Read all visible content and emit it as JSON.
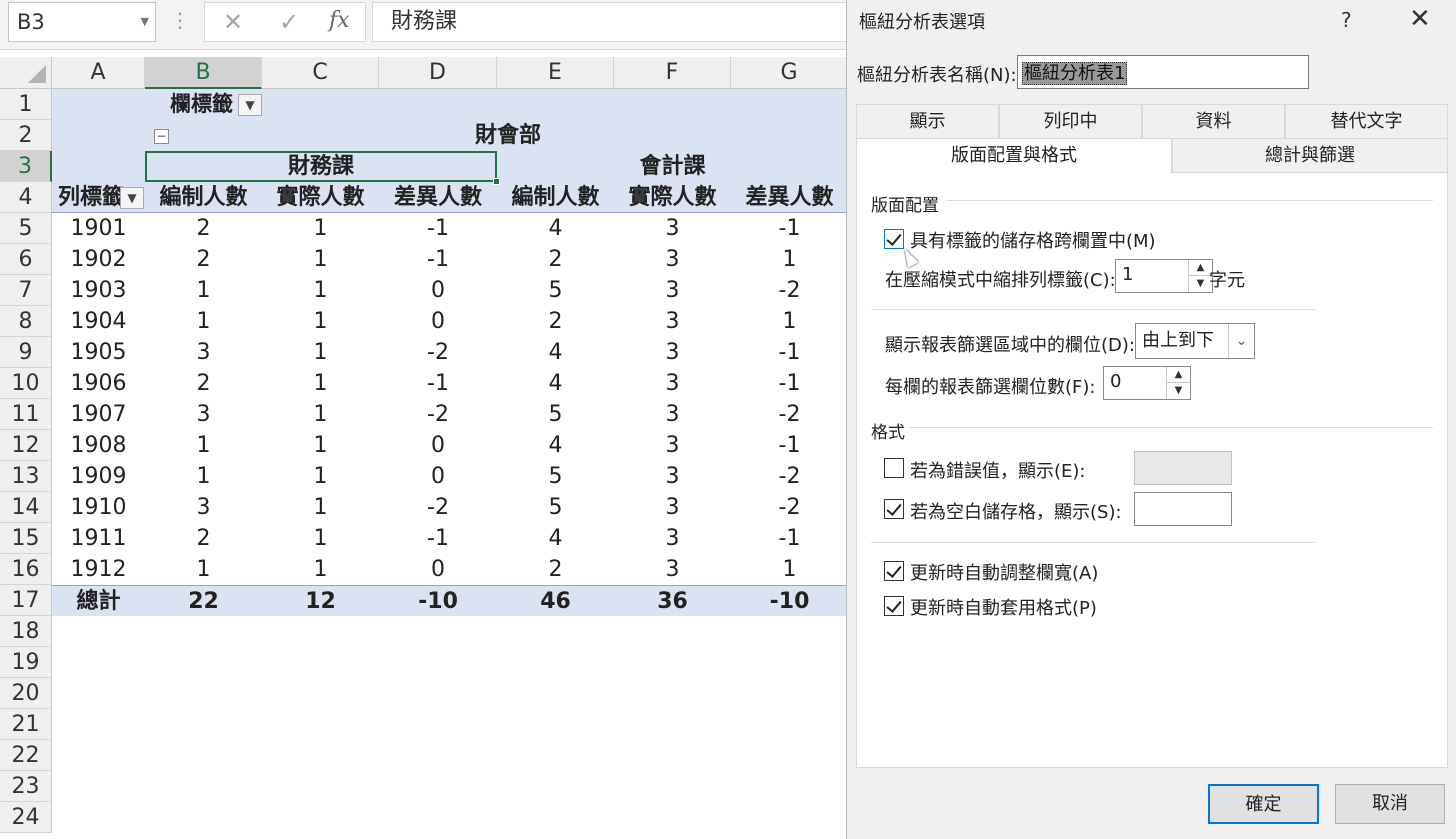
{
  "formula_bar": {
    "name_box": "B3",
    "cancel_icon": "✕",
    "enter_icon": "✓",
    "fx_icon": "fx",
    "content": "財務課"
  },
  "sheet": {
    "columns": [
      "A",
      "B",
      "C",
      "D",
      "E",
      "F",
      "G"
    ],
    "rows": [
      "1",
      "2",
      "3",
      "4",
      "5",
      "6",
      "7",
      "8",
      "9",
      "10",
      "11",
      "12",
      "13",
      "14",
      "15",
      "16",
      "17",
      "18",
      "19",
      "20",
      "21",
      "22",
      "23",
      "24"
    ],
    "selected_column": "B",
    "selected_row": "3",
    "band_color": "#dbe2f2",
    "pivot": {
      "column_labels_header": "欄標籤",
      "row_labels_header": "列標籤",
      "dept": "財會部",
      "group1": "財務課",
      "group2": "會計課",
      "measure_headers": [
        "編制人數",
        "實際人數",
        "差異人數",
        "編制人數",
        "實際人數",
        "差異人數"
      ],
      "rows": [
        {
          "label": "1901",
          "values": [
            "2",
            "1",
            "-1",
            "4",
            "3",
            "-1"
          ]
        },
        {
          "label": "1902",
          "values": [
            "2",
            "1",
            "-1",
            "2",
            "3",
            "1"
          ]
        },
        {
          "label": "1903",
          "values": [
            "1",
            "1",
            "0",
            "5",
            "3",
            "-2"
          ]
        },
        {
          "label": "1904",
          "values": [
            "1",
            "1",
            "0",
            "2",
            "3",
            "1"
          ]
        },
        {
          "label": "1905",
          "values": [
            "3",
            "1",
            "-2",
            "4",
            "3",
            "-1"
          ]
        },
        {
          "label": "1906",
          "values": [
            "2",
            "1",
            "-1",
            "4",
            "3",
            "-1"
          ]
        },
        {
          "label": "1907",
          "values": [
            "3",
            "1",
            "-2",
            "5",
            "3",
            "-2"
          ]
        },
        {
          "label": "1908",
          "values": [
            "1",
            "1",
            "0",
            "4",
            "3",
            "-1"
          ]
        },
        {
          "label": "1909",
          "values": [
            "1",
            "1",
            "0",
            "5",
            "3",
            "-2"
          ]
        },
        {
          "label": "1910",
          "values": [
            "3",
            "1",
            "-2",
            "5",
            "3",
            "-2"
          ]
        },
        {
          "label": "1911",
          "values": [
            "2",
            "1",
            "-1",
            "4",
            "3",
            "-1"
          ]
        },
        {
          "label": "1912",
          "values": [
            "1",
            "1",
            "0",
            "2",
            "3",
            "1"
          ]
        }
      ],
      "total": {
        "label": "總計",
        "values": [
          "22",
          "12",
          "-10",
          "46",
          "36",
          "-10"
        ]
      }
    }
  },
  "dialog": {
    "title": "樞紐分析表選項",
    "help": "?",
    "close": "✕",
    "name_label": "樞紐分析表名稱(N):",
    "name_value": "樞紐分析表1",
    "tabs_row1": [
      "顯示",
      "列印中",
      "資料",
      "替代文字"
    ],
    "tabs_row2": [
      "版面配置與格式",
      "總計與篩選"
    ],
    "active_tab": "版面配置與格式",
    "layout_section": "版面配置",
    "merge_center": {
      "label": "具有標籤的儲存格跨欄置中(M)",
      "checked": true
    },
    "indent": {
      "label": "在壓縮模式中縮排列標籤(C):",
      "value": "1",
      "unit": "字元"
    },
    "filter_order": {
      "label": "顯示報表篩選區域中的欄位(D):",
      "value": "由上到下"
    },
    "filter_per_col": {
      "label": "每欄的報表篩選欄位數(F):",
      "value": "0"
    },
    "format_section": "格式",
    "error_values": {
      "label": "若為錯誤值，顯示(E):",
      "checked": false,
      "value": ""
    },
    "empty_cells": {
      "label": "若為空白儲存格，顯示(S):",
      "checked": true,
      "value": ""
    },
    "autofit": {
      "label": "更新時自動調整欄寬(A)",
      "checked": true
    },
    "preserve_format": {
      "label": "更新時自動套用格式(P)",
      "checked": true
    },
    "ok": "確定",
    "cancel": "取消"
  }
}
